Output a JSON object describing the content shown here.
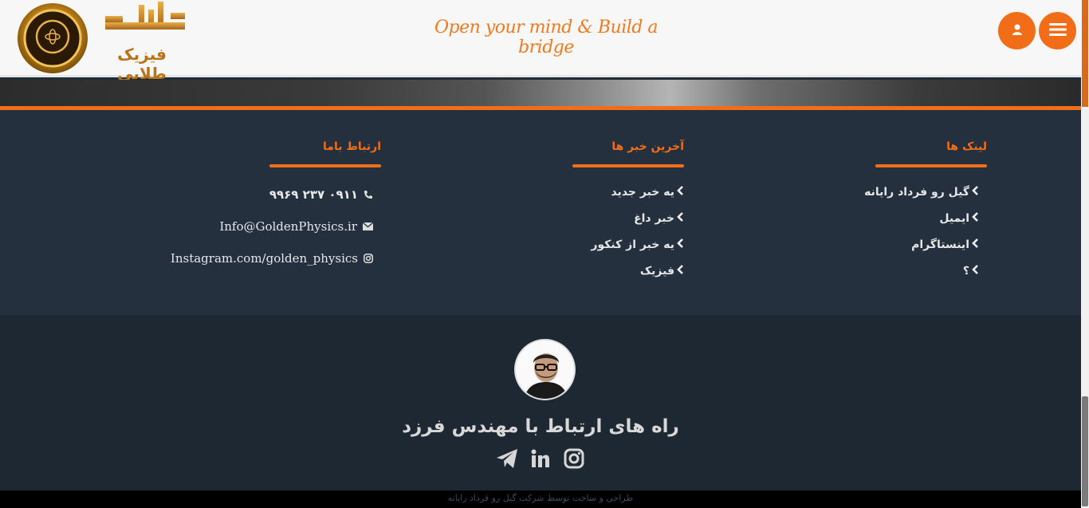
{
  "header": {
    "tagline": "Open your mind & Build a bridge",
    "logo_text": "فیزیک طلایی",
    "menu_icon": "hamburger-menu-icon",
    "user_icon": "user-icon"
  },
  "colors": {
    "accent": "#f26d18",
    "footer_top_bg": "#24303d",
    "footer_bottom_bg": "#1e2832",
    "header_bg": "#f7f7f7"
  },
  "footer": {
    "links": {
      "title": "لینک ها",
      "items": [
        "گیل رو فرداد رایانه",
        "ایمیل",
        "اینستاگرام",
        "؟"
      ]
    },
    "news": {
      "title": "آخرین خبر ها",
      "items": [
        "یه خبر جدید",
        "خبر داغ",
        "یه خبر از کنکور",
        "فیزیک"
      ]
    },
    "contact": {
      "title": "ارتباط باما",
      "phone": "۰۹۱۱ ۲۳۷ ۹۹۶۹",
      "email": "Info@GoldenPhysics.ir",
      "instagram": "Instagram.com/golden_physics"
    }
  },
  "developer": {
    "title": "راه های ارتباط با مهندس فرزد",
    "socials": [
      "instagram-icon",
      "linkedin-icon",
      "telegram-icon"
    ]
  },
  "copyright": "طراحی و ساخت توسط شرکت گیل رو فرداد رایانه"
}
